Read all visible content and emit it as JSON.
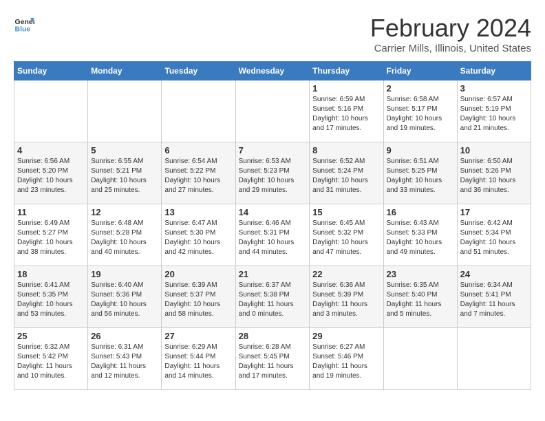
{
  "header": {
    "logo_line1": "General",
    "logo_line2": "Blue",
    "main_title": "February 2024",
    "subtitle": "Carrier Mills, Illinois, United States"
  },
  "weekdays": [
    "Sunday",
    "Monday",
    "Tuesday",
    "Wednesday",
    "Thursday",
    "Friday",
    "Saturday"
  ],
  "weeks": [
    [
      {
        "day": "",
        "sunrise": "",
        "sunset": "",
        "daylight": ""
      },
      {
        "day": "",
        "sunrise": "",
        "sunset": "",
        "daylight": ""
      },
      {
        "day": "",
        "sunrise": "",
        "sunset": "",
        "daylight": ""
      },
      {
        "day": "",
        "sunrise": "",
        "sunset": "",
        "daylight": ""
      },
      {
        "day": "1",
        "sunrise": "Sunrise: 6:59 AM",
        "sunset": "Sunset: 5:16 PM",
        "daylight": "Daylight: 10 hours and 17 minutes."
      },
      {
        "day": "2",
        "sunrise": "Sunrise: 6:58 AM",
        "sunset": "Sunset: 5:17 PM",
        "daylight": "Daylight: 10 hours and 19 minutes."
      },
      {
        "day": "3",
        "sunrise": "Sunrise: 6:57 AM",
        "sunset": "Sunset: 5:19 PM",
        "daylight": "Daylight: 10 hours and 21 minutes."
      }
    ],
    [
      {
        "day": "4",
        "sunrise": "Sunrise: 6:56 AM",
        "sunset": "Sunset: 5:20 PM",
        "daylight": "Daylight: 10 hours and 23 minutes."
      },
      {
        "day": "5",
        "sunrise": "Sunrise: 6:55 AM",
        "sunset": "Sunset: 5:21 PM",
        "daylight": "Daylight: 10 hours and 25 minutes."
      },
      {
        "day": "6",
        "sunrise": "Sunrise: 6:54 AM",
        "sunset": "Sunset: 5:22 PM",
        "daylight": "Daylight: 10 hours and 27 minutes."
      },
      {
        "day": "7",
        "sunrise": "Sunrise: 6:53 AM",
        "sunset": "Sunset: 5:23 PM",
        "daylight": "Daylight: 10 hours and 29 minutes."
      },
      {
        "day": "8",
        "sunrise": "Sunrise: 6:52 AM",
        "sunset": "Sunset: 5:24 PM",
        "daylight": "Daylight: 10 hours and 31 minutes."
      },
      {
        "day": "9",
        "sunrise": "Sunrise: 6:51 AM",
        "sunset": "Sunset: 5:25 PM",
        "daylight": "Daylight: 10 hours and 33 minutes."
      },
      {
        "day": "10",
        "sunrise": "Sunrise: 6:50 AM",
        "sunset": "Sunset: 5:26 PM",
        "daylight": "Daylight: 10 hours and 36 minutes."
      }
    ],
    [
      {
        "day": "11",
        "sunrise": "Sunrise: 6:49 AM",
        "sunset": "Sunset: 5:27 PM",
        "daylight": "Daylight: 10 hours and 38 minutes."
      },
      {
        "day": "12",
        "sunrise": "Sunrise: 6:48 AM",
        "sunset": "Sunset: 5:28 PM",
        "daylight": "Daylight: 10 hours and 40 minutes."
      },
      {
        "day": "13",
        "sunrise": "Sunrise: 6:47 AM",
        "sunset": "Sunset: 5:30 PM",
        "daylight": "Daylight: 10 hours and 42 minutes."
      },
      {
        "day": "14",
        "sunrise": "Sunrise: 6:46 AM",
        "sunset": "Sunset: 5:31 PM",
        "daylight": "Daylight: 10 hours and 44 minutes."
      },
      {
        "day": "15",
        "sunrise": "Sunrise: 6:45 AM",
        "sunset": "Sunset: 5:32 PM",
        "daylight": "Daylight: 10 hours and 47 minutes."
      },
      {
        "day": "16",
        "sunrise": "Sunrise: 6:43 AM",
        "sunset": "Sunset: 5:33 PM",
        "daylight": "Daylight: 10 hours and 49 minutes."
      },
      {
        "day": "17",
        "sunrise": "Sunrise: 6:42 AM",
        "sunset": "Sunset: 5:34 PM",
        "daylight": "Daylight: 10 hours and 51 minutes."
      }
    ],
    [
      {
        "day": "18",
        "sunrise": "Sunrise: 6:41 AM",
        "sunset": "Sunset: 5:35 PM",
        "daylight": "Daylight: 10 hours and 53 minutes."
      },
      {
        "day": "19",
        "sunrise": "Sunrise: 6:40 AM",
        "sunset": "Sunset: 5:36 PM",
        "daylight": "Daylight: 10 hours and 56 minutes."
      },
      {
        "day": "20",
        "sunrise": "Sunrise: 6:39 AM",
        "sunset": "Sunset: 5:37 PM",
        "daylight": "Daylight: 10 hours and 58 minutes."
      },
      {
        "day": "21",
        "sunrise": "Sunrise: 6:37 AM",
        "sunset": "Sunset: 5:38 PM",
        "daylight": "Daylight: 11 hours and 0 minutes."
      },
      {
        "day": "22",
        "sunrise": "Sunrise: 6:36 AM",
        "sunset": "Sunset: 5:39 PM",
        "daylight": "Daylight: 11 hours and 3 minutes."
      },
      {
        "day": "23",
        "sunrise": "Sunrise: 6:35 AM",
        "sunset": "Sunset: 5:40 PM",
        "daylight": "Daylight: 11 hours and 5 minutes."
      },
      {
        "day": "24",
        "sunrise": "Sunrise: 6:34 AM",
        "sunset": "Sunset: 5:41 PM",
        "daylight": "Daylight: 11 hours and 7 minutes."
      }
    ],
    [
      {
        "day": "25",
        "sunrise": "Sunrise: 6:32 AM",
        "sunset": "Sunset: 5:42 PM",
        "daylight": "Daylight: 11 hours and 10 minutes."
      },
      {
        "day": "26",
        "sunrise": "Sunrise: 6:31 AM",
        "sunset": "Sunset: 5:43 PM",
        "daylight": "Daylight: 11 hours and 12 minutes."
      },
      {
        "day": "27",
        "sunrise": "Sunrise: 6:29 AM",
        "sunset": "Sunset: 5:44 PM",
        "daylight": "Daylight: 11 hours and 14 minutes."
      },
      {
        "day": "28",
        "sunrise": "Sunrise: 6:28 AM",
        "sunset": "Sunset: 5:45 PM",
        "daylight": "Daylight: 11 hours and 17 minutes."
      },
      {
        "day": "29",
        "sunrise": "Sunrise: 6:27 AM",
        "sunset": "Sunset: 5:46 PM",
        "daylight": "Daylight: 11 hours and 19 minutes."
      },
      {
        "day": "",
        "sunrise": "",
        "sunset": "",
        "daylight": ""
      },
      {
        "day": "",
        "sunrise": "",
        "sunset": "",
        "daylight": ""
      }
    ]
  ]
}
